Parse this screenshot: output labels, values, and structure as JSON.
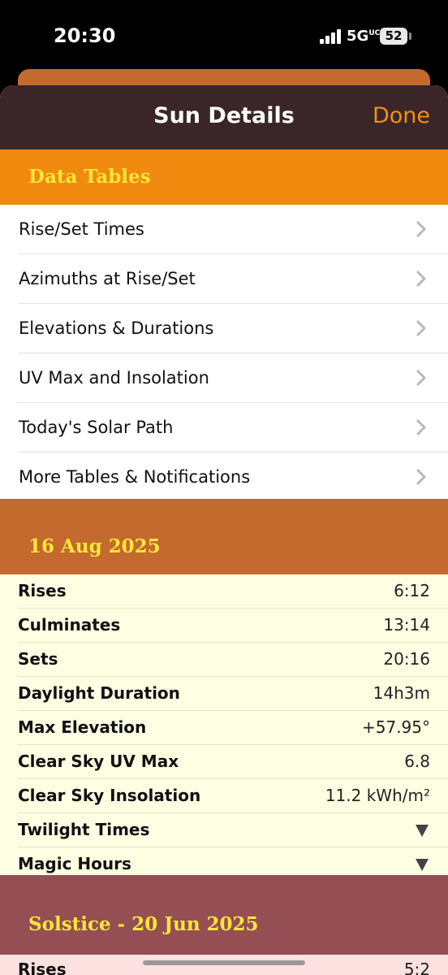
{
  "status": {
    "time": "20:30",
    "network": "5G",
    "network_sup": "UC",
    "battery": "52"
  },
  "nav": {
    "title": "Sun Details",
    "done_label": "Done"
  },
  "tables_section": {
    "title": "Data Tables",
    "items": [
      {
        "label": "Rise/Set Times"
      },
      {
        "label": "Azimuths at Rise/Set"
      },
      {
        "label": "Elevations & Durations"
      },
      {
        "label": "UV Max and Insolation"
      },
      {
        "label": "Today's Solar Path"
      },
      {
        "label": "More Tables & Notifications"
      }
    ]
  },
  "today": {
    "date": "16 Aug 2025",
    "rows": [
      {
        "label": "Rises",
        "value": "6:12"
      },
      {
        "label": "Culminates",
        "value": "13:14"
      },
      {
        "label": "Sets",
        "value": "20:16"
      },
      {
        "label": "Daylight Duration",
        "value": "14h3m"
      },
      {
        "label": "Max Elevation",
        "value": "+57.95°"
      },
      {
        "label": "Clear Sky UV Max",
        "value": "6.8"
      },
      {
        "label": "Clear Sky Insolation",
        "value": "11.2 kWh/m²"
      },
      {
        "label": "Twilight Times",
        "value": ""
      },
      {
        "label": "Magic Hours",
        "value": ""
      }
    ]
  },
  "solstice": {
    "title": "Solstice - 20 Jun 2025",
    "first_row": {
      "label": "Rises",
      "value": "5:2"
    }
  },
  "colors": {
    "nav_bg": "#3a2528",
    "accent": "#f0930e",
    "tables_header": "#f28a0f",
    "date_header": "#c46a2e",
    "solstice_header": "#954f54",
    "header_text": "#fae63a"
  }
}
